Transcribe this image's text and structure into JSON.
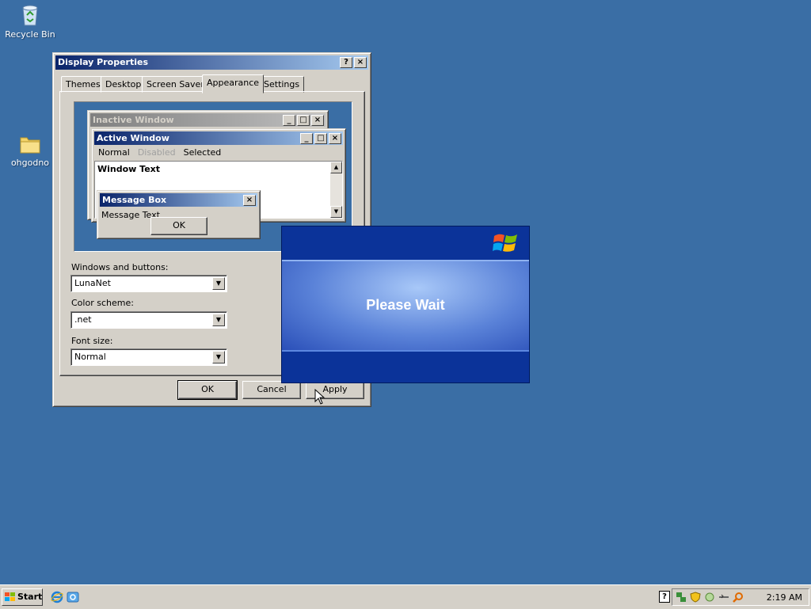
{
  "desktop": {
    "icons": [
      {
        "label": "Recycle Bin",
        "icon": "recycle-bin-icon"
      },
      {
        "label": "ohgodno",
        "icon": "folder-icon"
      }
    ]
  },
  "dialog": {
    "title": "Display Properties",
    "help_btn": "?",
    "close_btn": "×",
    "tabs": [
      "Themes",
      "Desktop",
      "Screen Saver",
      "Appearance",
      "Settings"
    ],
    "active_tab": "Appearance",
    "preview": {
      "inactive_title": "Inactive Window",
      "active_title": "Active Window",
      "menu": [
        "Normal",
        "Disabled",
        "Selected"
      ],
      "window_text": "Window Text",
      "msgbox_title": "Message Box",
      "msgbox_text": "Message Text",
      "msgbox_ok": "OK"
    },
    "fields": {
      "windows_buttons_label": "Windows and buttons:",
      "windows_buttons_value": "LunaNet",
      "color_scheme_label": "Color scheme:",
      "color_scheme_value": ".net",
      "font_size_label": "Font size:",
      "font_size_value": "Normal"
    },
    "buttons": {
      "ok": "OK",
      "cancel": "Cancel",
      "apply": "Apply"
    }
  },
  "splash": {
    "text": "Please Wait"
  },
  "taskbar": {
    "start": "Start",
    "clock": "2:19 AM"
  },
  "colors": {
    "desktop": "#3a6ea5",
    "title_active": "#0a246a",
    "splash_band": "#0b3399"
  }
}
